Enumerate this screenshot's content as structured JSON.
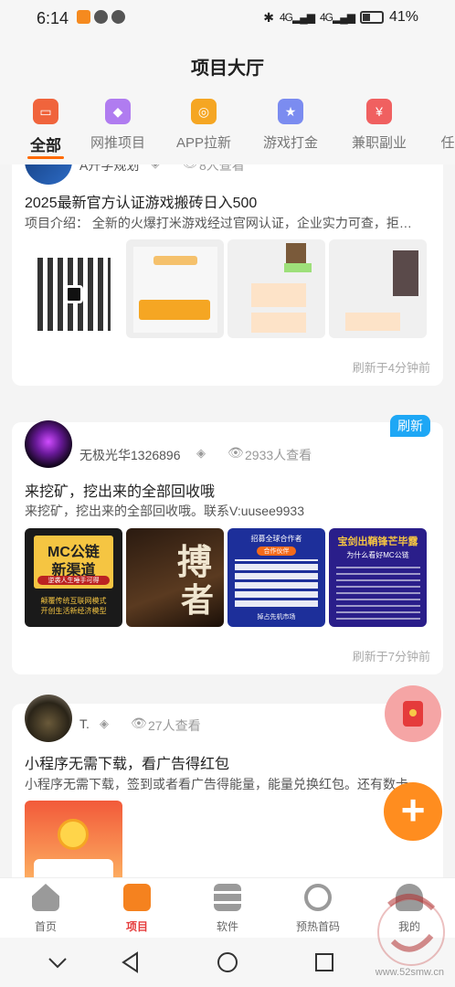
{
  "status": {
    "time": "6:14",
    "battery": "41%",
    "battery_level": 0.41,
    "net1": "4G",
    "net2": "4G"
  },
  "header": {
    "title": "项目大厅"
  },
  "categories": [
    {
      "label": "全部",
      "icon": "shop-icon",
      "color": "#f0643c"
    },
    {
      "label": "网推项目",
      "icon": "gem-icon",
      "color": "#b07cf0"
    },
    {
      "label": "APP拉新",
      "icon": "target-icon",
      "color": "#f5a623"
    },
    {
      "label": "游戏打金",
      "icon": "star-icon",
      "color": "#7b8cf0"
    },
    {
      "label": "兼职副业",
      "icon": "yen-icon",
      "color": "#f06060"
    },
    {
      "label": "任",
      "icon": "more-icon",
      "color": "#ccc"
    }
  ],
  "posts": [
    {
      "user": "A升学规划",
      "views": "8人查看",
      "title": "2025最新官方认证游戏搬砖日入500",
      "desc": "项目介绍： 全新的火爆打米游戏经过官网认证，企业实力可查，拒…",
      "refresh": "刷新于4分钟前"
    },
    {
      "user": "无极光华1326896",
      "views": "2933人查看",
      "title": "来挖矿，挖出来的全部回收哦",
      "desc": "来挖矿，挖出来的全部回收哦。联系V:uusee9933",
      "refresh": "刷新于7分钟前",
      "badge": "刷新",
      "thumb_texts": {
        "t1_line1": "MC公链",
        "t1_line2": "新渠道",
        "t1_sub": "逆袭人生唾手可得",
        "t1_foot": "颠覆传统互联网模式\n开创生活新经济模型",
        "t2_big": "搏",
        "t2_big2": "者",
        "t3_head": "招募全球合作者",
        "t3_btn": "合作伙伴",
        "t3_foot": "掉占先机市场",
        "t4_head": "宝剑出鞘锋芒毕露",
        "t4_sub": "为什么看好MC公链"
      }
    },
    {
      "user": "T.",
      "views": "27人查看",
      "title": "小程序无需下载，看广告得红包",
      "desc": "小程序无需下载，签到或者看广告得能量，能量兑换红包。还有数卡"
    }
  ],
  "tabs": [
    {
      "label": "首页",
      "icon": "home-icon"
    },
    {
      "label": "项目",
      "icon": "project-icon"
    },
    {
      "label": "软件",
      "icon": "software-icon"
    },
    {
      "label": "预热首码",
      "icon": "timer-icon"
    },
    {
      "label": "我的",
      "icon": "profile-icon"
    }
  ],
  "watermark": {
    "url": "www.52smw.cn"
  }
}
